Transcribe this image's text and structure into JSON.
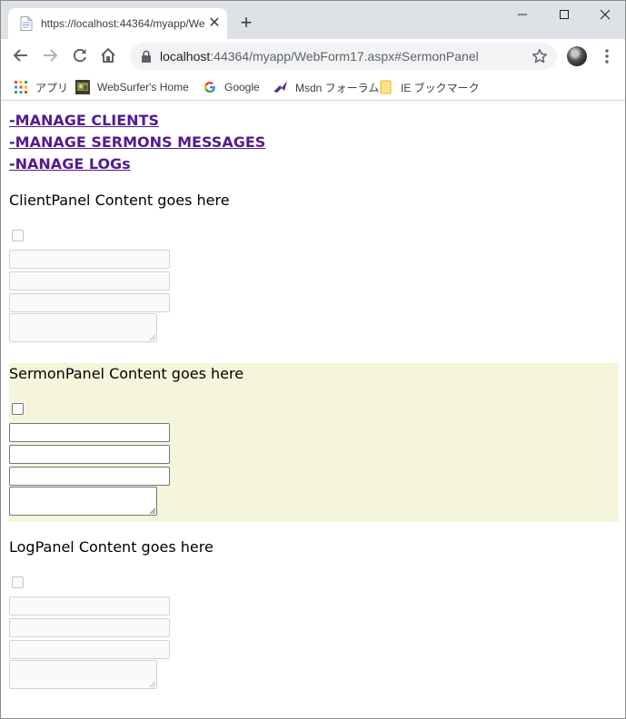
{
  "browser": {
    "tab_title": "https://localhost:44364/myapp/WebForm17.aspx#SermonPanel",
    "new_tab_label": "+",
    "url_host": "localhost",
    "url_rest": ":44364/myapp/WebForm17.aspx#SermonPanel"
  },
  "bookmarks": [
    {
      "label": "アプリ",
      "icon": "apps-grid-icon"
    },
    {
      "label": "WebSurfer's Home",
      "icon": "site-favicon"
    },
    {
      "label": "Google",
      "icon": "google-icon"
    },
    {
      "label": "Msdn フォーラム",
      "icon": "msdn-icon"
    },
    {
      "label": "IE ブックマーク",
      "icon": "folder-icon"
    }
  ],
  "page": {
    "links": [
      "-MANAGE CLIENTS",
      "-MANAGE SERMONS MESSAGES",
      "-NANAGE LOGs"
    ],
    "panels": [
      {
        "title": "ClientPanel Content goes here",
        "enabled": false
      },
      {
        "title": "SermonPanel Content goes here",
        "enabled": true
      },
      {
        "title": "LogPanel Content goes here",
        "enabled": false
      }
    ]
  },
  "colors": {
    "link_visited": "#551a8b",
    "active_panel_bg": "#f5f5dc",
    "tabstrip_bg": "#dee1e6"
  }
}
